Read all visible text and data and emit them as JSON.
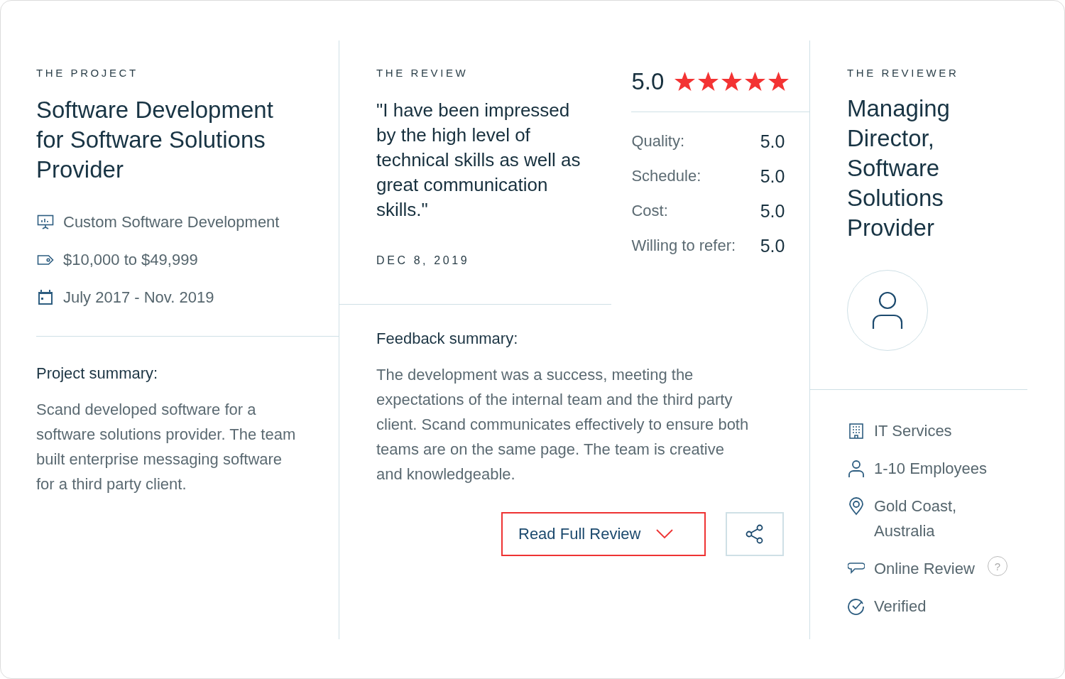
{
  "project": {
    "heading": "THE PROJECT",
    "title": "Software Development for Software Solutions Provider",
    "details": [
      "Custom Software Development",
      "$10,000 to $49,999",
      "July 2017 - Nov. 2019"
    ],
    "summary_label": "Project summary:",
    "summary": "Scand developed software for a software solutions provider. The team built enterprise messaging software for a third party client."
  },
  "review": {
    "heading": "THE REVIEW",
    "quote": "\"I have been impressed by the high level of technical skills as well as great communication skills.\"",
    "date": "DEC 8, 2019",
    "rating": {
      "score": "5.0",
      "stars": 5
    },
    "scores": [
      {
        "label": "Quality:",
        "value": "5.0"
      },
      {
        "label": "Schedule:",
        "value": "5.0"
      },
      {
        "label": "Cost:",
        "value": "5.0"
      },
      {
        "label": "Willing to refer:",
        "value": "5.0"
      }
    ],
    "feedback_label": "Feedback summary:",
    "feedback": "The development was a success, meeting the expectations of the internal team and the third party client. Scand communicates effectively to ensure both teams are on the same page. The team is creative and knowledgeable.",
    "read_button": {
      "label": "Read Full Review",
      "highlighted": true
    }
  },
  "reviewer": {
    "heading": "THE REVIEWER",
    "title": "Managing Director, Software Solutions Provider",
    "details": [
      {
        "text": "IT Services"
      },
      {
        "text": "1-10 Employees"
      },
      {
        "text": "Gold Coast, Australia"
      },
      {
        "text": "Online Review",
        "help_icon": "?"
      },
      {
        "text": "Verified"
      }
    ]
  }
}
